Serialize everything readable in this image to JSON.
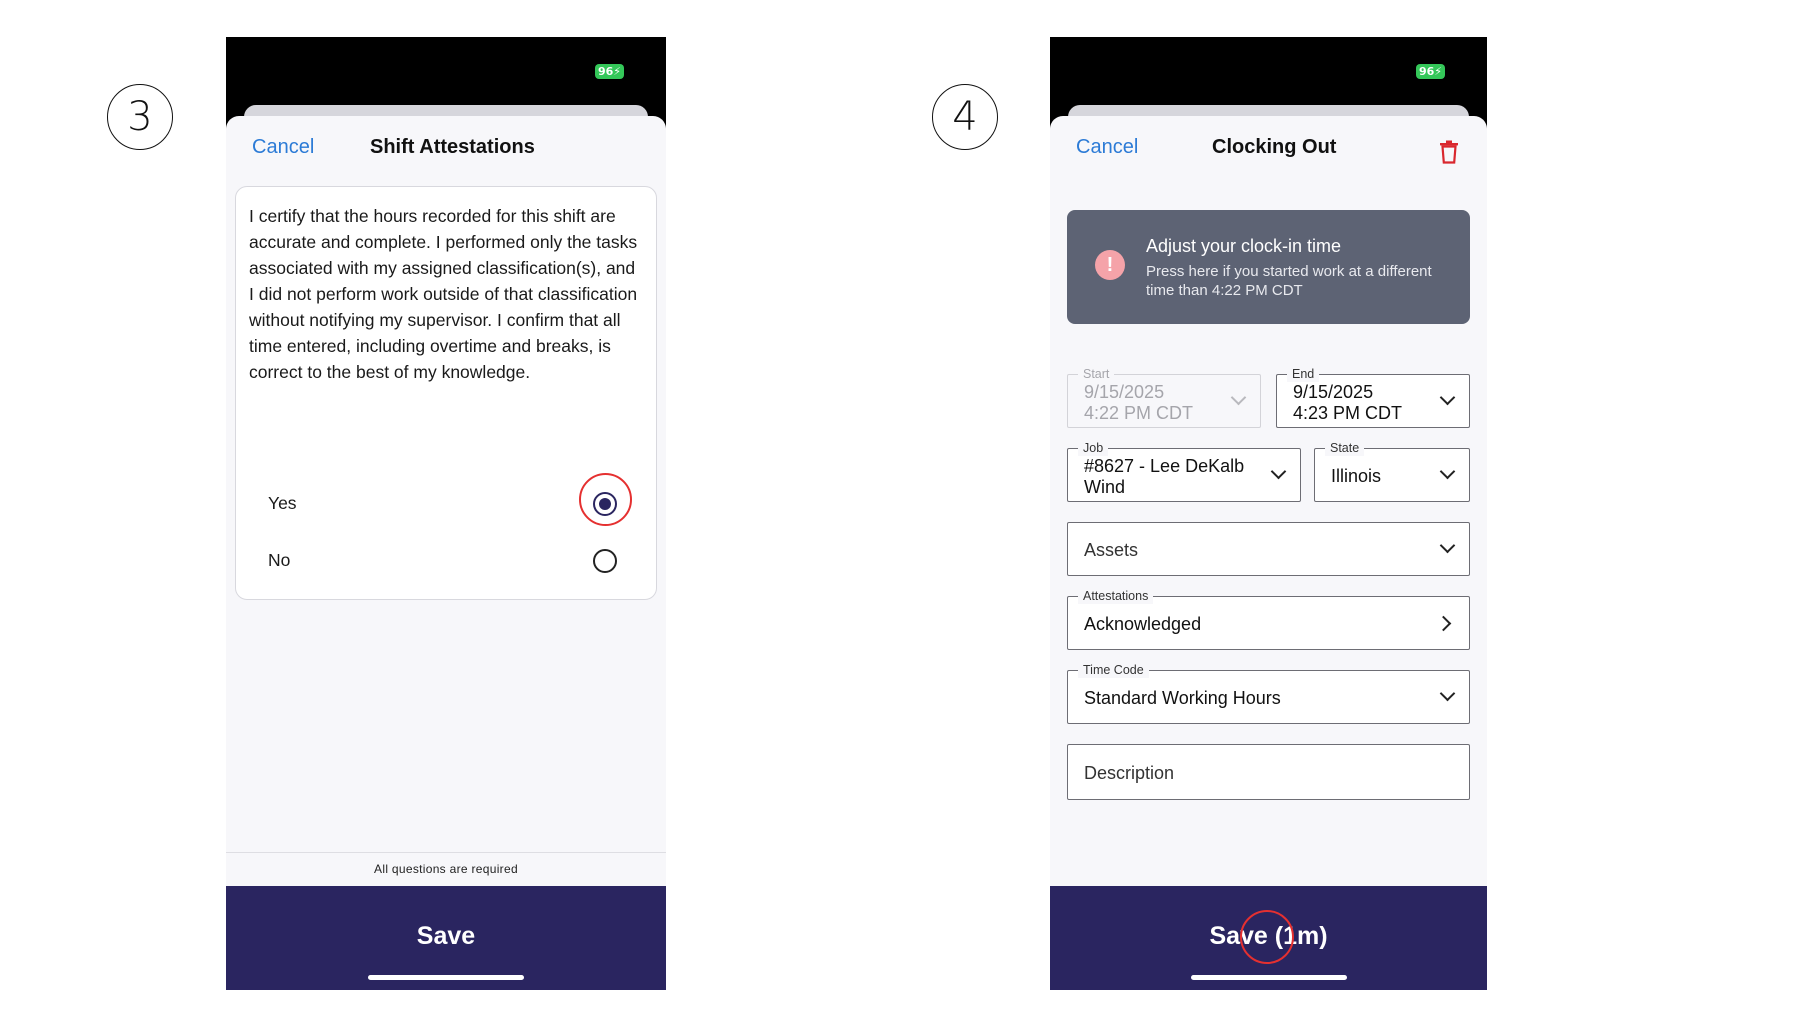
{
  "steps": [
    "3",
    "4"
  ],
  "colors": {
    "accent_blue": "#2c7bd6",
    "primary_navy": "#2a2560",
    "banner_gray": "#5d6374",
    "highlight_red": "#e53030",
    "battery_green": "#34c759"
  },
  "phone3": {
    "status": {
      "battery": "96"
    },
    "nav": {
      "cancel": "Cancel",
      "title": "Shift Attestations"
    },
    "attestation_text": "I certify that the hours recorded for this shift are accurate and complete. I performed only the tasks associated with my assigned classification(s), and I did not perform work outside of that classification without notifying my supervisor. I confirm that all time entered, including overtime and breaks, is correct to the best of my knowledge.",
    "options": [
      {
        "label": "Yes",
        "selected": true
      },
      {
        "label": "No",
        "selected": false
      }
    ],
    "footer_note": "All questions are required",
    "save_label": "Save"
  },
  "phone4": {
    "status": {
      "battery": "96"
    },
    "nav": {
      "cancel": "Cancel",
      "title": "Clocking Out",
      "delete_icon": "trash-icon"
    },
    "banner": {
      "icon": "exclamation-icon",
      "title": "Adjust your clock-in time",
      "subtitle": "Press here if you started work at a different time than 4:22 PM CDT"
    },
    "start": {
      "label": "Start",
      "date": "9/15/2025",
      "time": "4:22 PM CDT"
    },
    "end": {
      "label": "End",
      "date": "9/15/2025",
      "time": "4:23 PM CDT"
    },
    "job": {
      "label": "Job",
      "line1": "#8627 - Lee DeKalb",
      "line2": "Wind"
    },
    "state": {
      "label": "State",
      "value": "Illinois"
    },
    "assets": {
      "placeholder": "Assets"
    },
    "attestations": {
      "label": "Attestations",
      "value": "Acknowledged"
    },
    "time_code": {
      "label": "Time Code",
      "value": "Standard Working Hours"
    },
    "description": {
      "placeholder": "Description"
    },
    "save_label": "Save (1m)"
  }
}
